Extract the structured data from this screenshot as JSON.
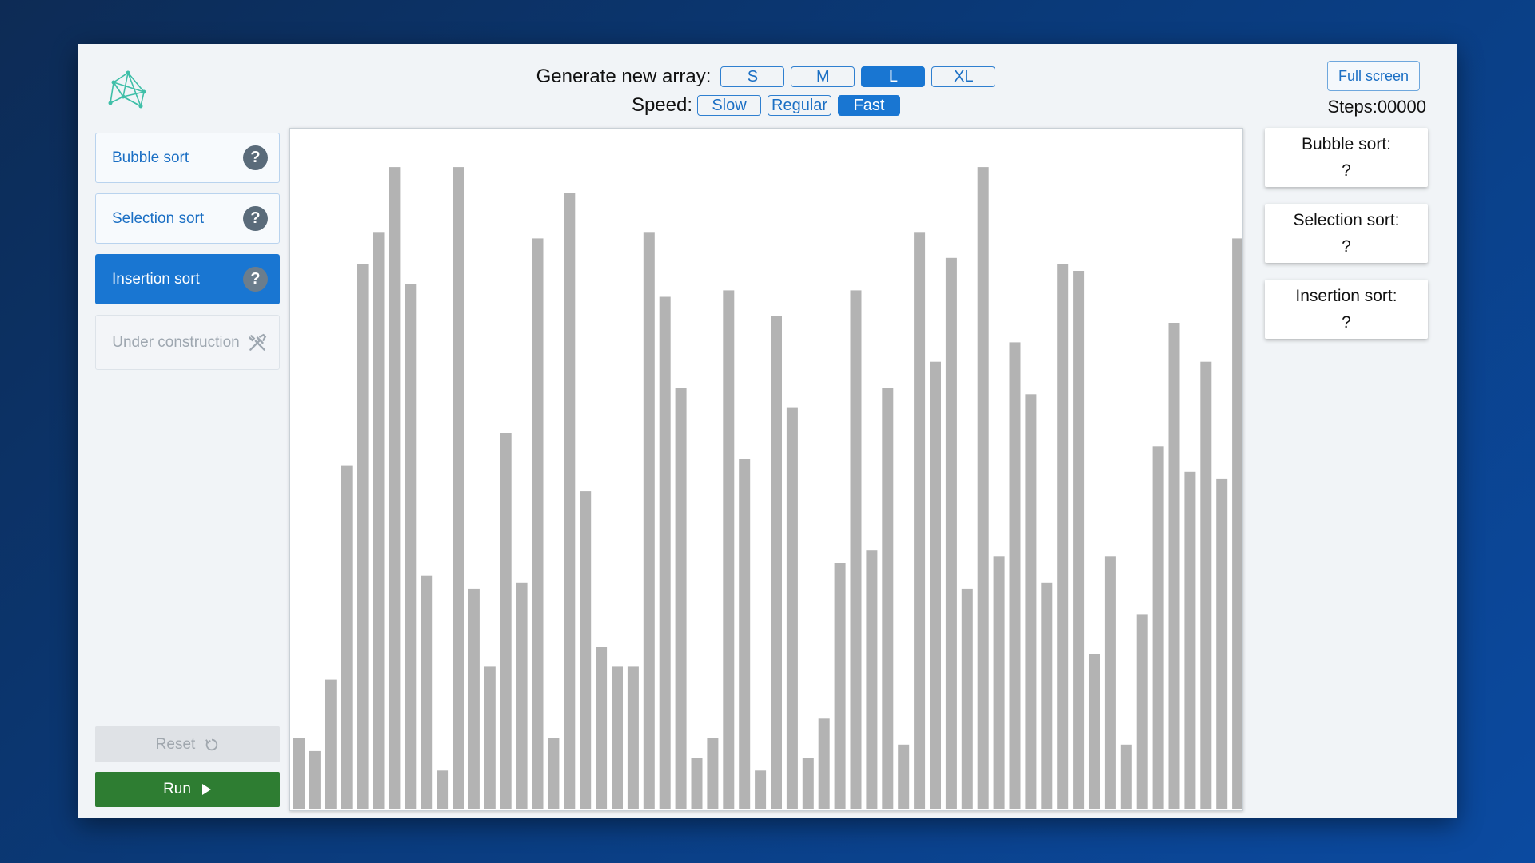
{
  "header": {
    "generate_label": "Generate new array:",
    "sizes": [
      {
        "label": "S",
        "active": false
      },
      {
        "label": "M",
        "active": false
      },
      {
        "label": "L",
        "active": true
      },
      {
        "label": "XL",
        "active": false
      }
    ],
    "speed_label": "Speed:",
    "speeds": [
      {
        "label": "Slow",
        "active": false
      },
      {
        "label": "Regular",
        "active": false
      },
      {
        "label": "Fast",
        "active": true
      }
    ],
    "fullscreen_label": "Full screen",
    "steps_label": "Steps:",
    "steps_value": "00000"
  },
  "sidebar": {
    "items": [
      {
        "label": "Bubble sort",
        "help": "?",
        "active": false
      },
      {
        "label": "Selection sort",
        "help": "?",
        "active": false
      },
      {
        "label": "Insertion sort",
        "help": "?",
        "active": true
      }
    ],
    "construction_label": "Under construction",
    "construction_icon": "tools-icon",
    "reset_label": "Reset",
    "reset_icon": "reset-icon",
    "run_label": "Run",
    "run_icon": "play-icon"
  },
  "results": [
    {
      "label": "Bubble sort:",
      "value": "?"
    },
    {
      "label": "Selection sort:",
      "value": "?"
    },
    {
      "label": "Insertion sort:",
      "value": "?"
    }
  ],
  "colors": {
    "accent": "#1976d2",
    "run": "#2e7d32",
    "bar": "#b3b3b3"
  },
  "chart_data": {
    "type": "bar",
    "values": [
      11,
      9,
      20,
      53,
      84,
      89,
      99,
      81,
      36,
      6,
      99,
      34,
      22,
      58,
      35,
      88,
      11,
      95,
      49,
      25,
      22,
      22,
      89,
      79,
      65,
      8,
      11,
      80,
      54,
      6,
      76,
      62,
      8,
      14,
      38,
      80,
      40,
      65,
      10,
      89,
      69,
      85,
      34,
      99,
      39,
      72,
      64,
      35,
      84,
      83,
      24,
      39,
      10,
      30,
      56,
      75,
      52,
      69,
      51,
      88
    ],
    "ylim": [
      0,
      100
    ]
  }
}
